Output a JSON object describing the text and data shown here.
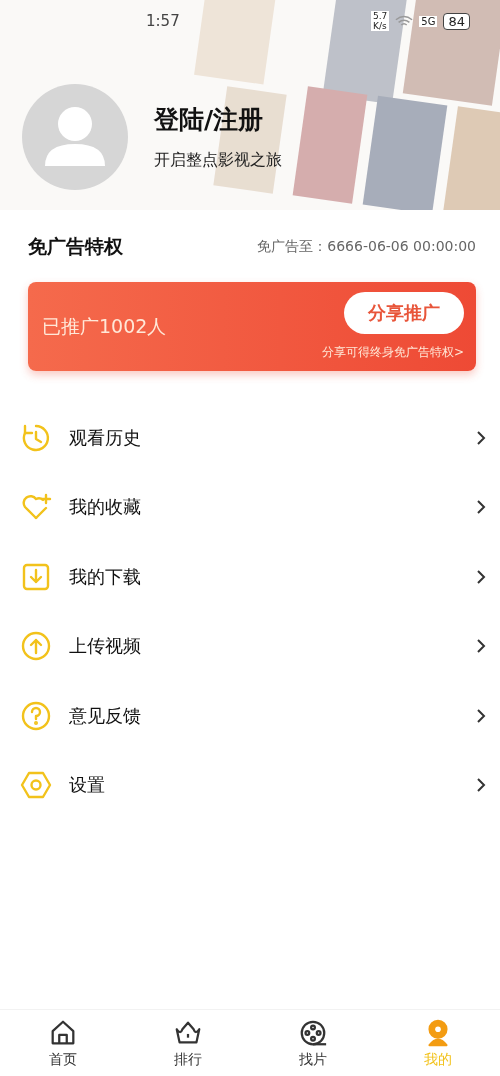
{
  "status_bar": {
    "time": "1:57",
    "network_speed": "5.7\nK/s",
    "signal": "5G",
    "battery": "84"
  },
  "profile": {
    "title": "登陆/注册",
    "subtitle": "开启整点影视之旅"
  },
  "ad_free": {
    "title": "免广告特权",
    "expiry": "免广告至：6666-06-06 00:00:00",
    "promoted": "已推广1002人",
    "share_button": "分享推广",
    "share_hint": "分享可得终身免广告特权>"
  },
  "menu": [
    {
      "label": "观看历史"
    },
    {
      "label": "我的收藏"
    },
    {
      "label": "我的下载"
    },
    {
      "label": "上传视频"
    },
    {
      "label": "意见反馈"
    },
    {
      "label": "设置"
    }
  ],
  "tabs": [
    {
      "label": "首页",
      "selected": false
    },
    {
      "label": "排行",
      "selected": false
    },
    {
      "label": "找片",
      "selected": false
    },
    {
      "label": "我的",
      "selected": true
    }
  ]
}
